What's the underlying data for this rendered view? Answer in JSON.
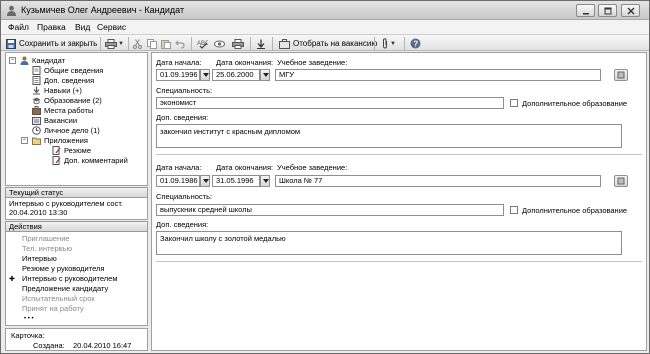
{
  "window": {
    "title": "Кузьмичев Олег Андреевич - Кандидат"
  },
  "menu": [
    "Файл",
    "Правка",
    "Вид",
    "Сервис"
  ],
  "toolbar": {
    "save_close_label": "Сохранить и закрыть",
    "assign_vacancy_label": "Отобрать на вакансию"
  },
  "tree": {
    "root": "Кандидат",
    "items": [
      "Общие сведения",
      "Доп. сведения",
      "Навыки (+)",
      "Образование (2)",
      "Места работы",
      "Вакансии",
      "Личное дело  (1)",
      "Приложения"
    ],
    "attachments": [
      "Резюме",
      "Доп. комментарий"
    ]
  },
  "status": {
    "header": "Текущий статус",
    "line1": "Интервью с руководителем сост.",
    "line2": "20.04.2010 13:30"
  },
  "actions": {
    "header": "Действия",
    "items": [
      {
        "label": "Приглашение",
        "muted": true
      },
      {
        "label": "Тел. интервью",
        "muted": true
      },
      {
        "label": "Интервью",
        "muted": false
      },
      {
        "label": "Резюме у руководителя",
        "muted": false
      },
      {
        "label": "Интервью с руководителем",
        "muted": false
      },
      {
        "label": "Предложение кандидату",
        "muted": false
      },
      {
        "label": "Испытательный срок",
        "muted": true
      },
      {
        "label": "Принят на работу",
        "muted": true
      }
    ],
    "more": "• • •"
  },
  "card": {
    "label": "Карточка:",
    "created_label": "Создана:",
    "created_value": "20.04.2010 16:47"
  },
  "education": [
    {
      "start_label": "Дата начала:",
      "start": "01.09.1996",
      "end_label": "Дата окончания:",
      "end": "25.06.2000",
      "institution_label": "Учебное заведение:",
      "institution": "МГУ",
      "specialty_label": "Специальность:",
      "specialty": "экономист",
      "additional_label": "Дополнительное образование",
      "notes_label": "Доп. сведения:",
      "notes": "закончил институт с красным дипломом"
    },
    {
      "start_label": "Дата начала:",
      "start": "01.09.1986",
      "end_label": "Дата окончания:",
      "end": "31.05.1996",
      "institution_label": "Учебное заведение:",
      "institution": "Школа № 77",
      "specialty_label": "Специальность:",
      "specialty": "выпускник средней школы",
      "additional_label": "Дополнительное образование",
      "notes_label": "Доп. сведения:",
      "notes": "Закончил школу с золотой медалью"
    }
  ]
}
